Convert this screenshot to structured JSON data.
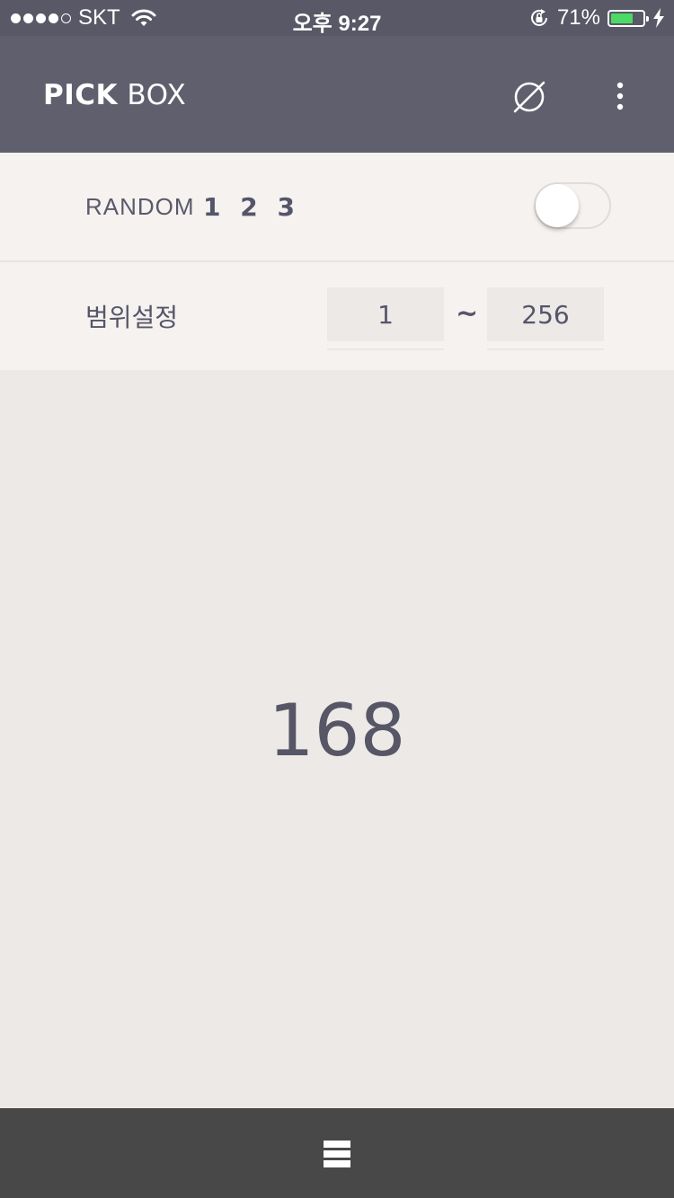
{
  "status_bar": {
    "carrier": "SKT",
    "signal_bars_filled": 4,
    "signal_bars_total": 5,
    "time": "오후 9:27",
    "battery_percent_label": "71%",
    "battery_level": 0.71,
    "battery_color": "#4cd964",
    "icons": [
      "wifi-icon",
      "rotation-lock-icon",
      "battery-icon",
      "charging-bolt-icon"
    ]
  },
  "app_bar": {
    "title_bold": "PICK",
    "title_light": " BOX",
    "actions": [
      "empty-set-icon",
      "more-vert-icon"
    ],
    "color": "#5f5f6e"
  },
  "random_row": {
    "label": "RANDOM",
    "numbers": "1 2 3",
    "toggle_on": false
  },
  "range_row": {
    "label": "범위설정",
    "min_value": "1",
    "separator": "~",
    "max_value": "256"
  },
  "result": {
    "value": "168"
  },
  "bottom_bar": {
    "menu_icon": "menu-stack-icon",
    "color": "#484848"
  }
}
